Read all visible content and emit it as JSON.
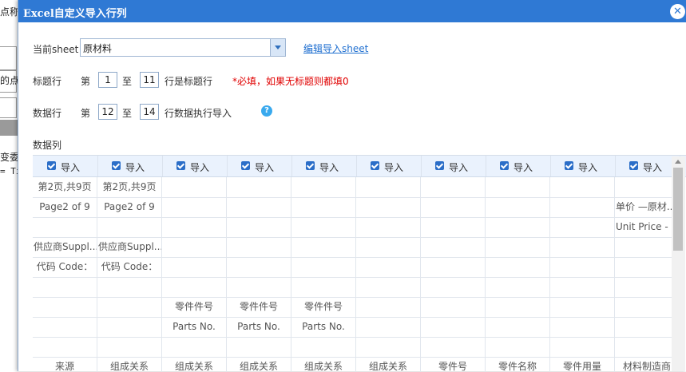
{
  "background": {
    "fragment1": "点称",
    "fragment2": "的点",
    "fragment3": "变委",
    "fragment4": "= Ti"
  },
  "dialog": {
    "title": "Excel自定义导入行列",
    "close_icon": "close-icon"
  },
  "sheet": {
    "label": "当前sheet",
    "selected": "原材料",
    "edit_link": "编辑导入sheet"
  },
  "title_row": {
    "label": "标题行",
    "prefix": "第",
    "from": "1",
    "to_word": "至",
    "to": "11",
    "suffix": "行是标题行",
    "required_note": "*必填，如果无标题则都填0"
  },
  "data_row": {
    "label": "数据行",
    "prefix": "第",
    "from": "12",
    "to_word": "至",
    "to": "14",
    "suffix": "行数据执行导入",
    "help_icon": "help-icon"
  },
  "data_columns": {
    "label": "数据列",
    "header_label": "导入",
    "header_count": 10,
    "rows": [
      [
        "第2页,共9页",
        "第2页,共9页",
        "",
        "",
        "",
        "",
        "",
        "",
        "",
        ""
      ],
      [
        "Page2 of 9",
        "Page2 of 9",
        "",
        "",
        "",
        "",
        "",
        "",
        "",
        "单价 —原材..."
      ],
      [
        "",
        "",
        "",
        "",
        "",
        "",
        "",
        "",
        "",
        "Unit Price -"
      ],
      [
        "供应商Suppl...",
        "供应商Suppl...",
        "",
        "",
        "",
        "",
        "",
        "",
        "",
        ""
      ],
      [
        "代码 Code：",
        "代码 Code：",
        "",
        "",
        "",
        "",
        "",
        "",
        "",
        ""
      ],
      [
        "",
        "",
        "",
        "",
        "",
        "",
        "",
        "",
        "",
        ""
      ],
      [
        "",
        "",
        "零件件号",
        "零件件号",
        "零件件号",
        "",
        "",
        "",
        "",
        ""
      ],
      [
        "",
        "",
        "Parts No.",
        "Parts No.",
        "Parts No.",
        "",
        "",
        "",
        "",
        ""
      ],
      [
        "",
        "",
        "",
        "",
        "",
        "",
        "",
        "",
        "",
        ""
      ],
      [
        "来源",
        "组成关系",
        "组成关系",
        "组成关系",
        "组成关系",
        "组成关系",
        "零件号",
        "零件名称",
        "零件用量",
        "材料制造商"
      ]
    ]
  }
}
